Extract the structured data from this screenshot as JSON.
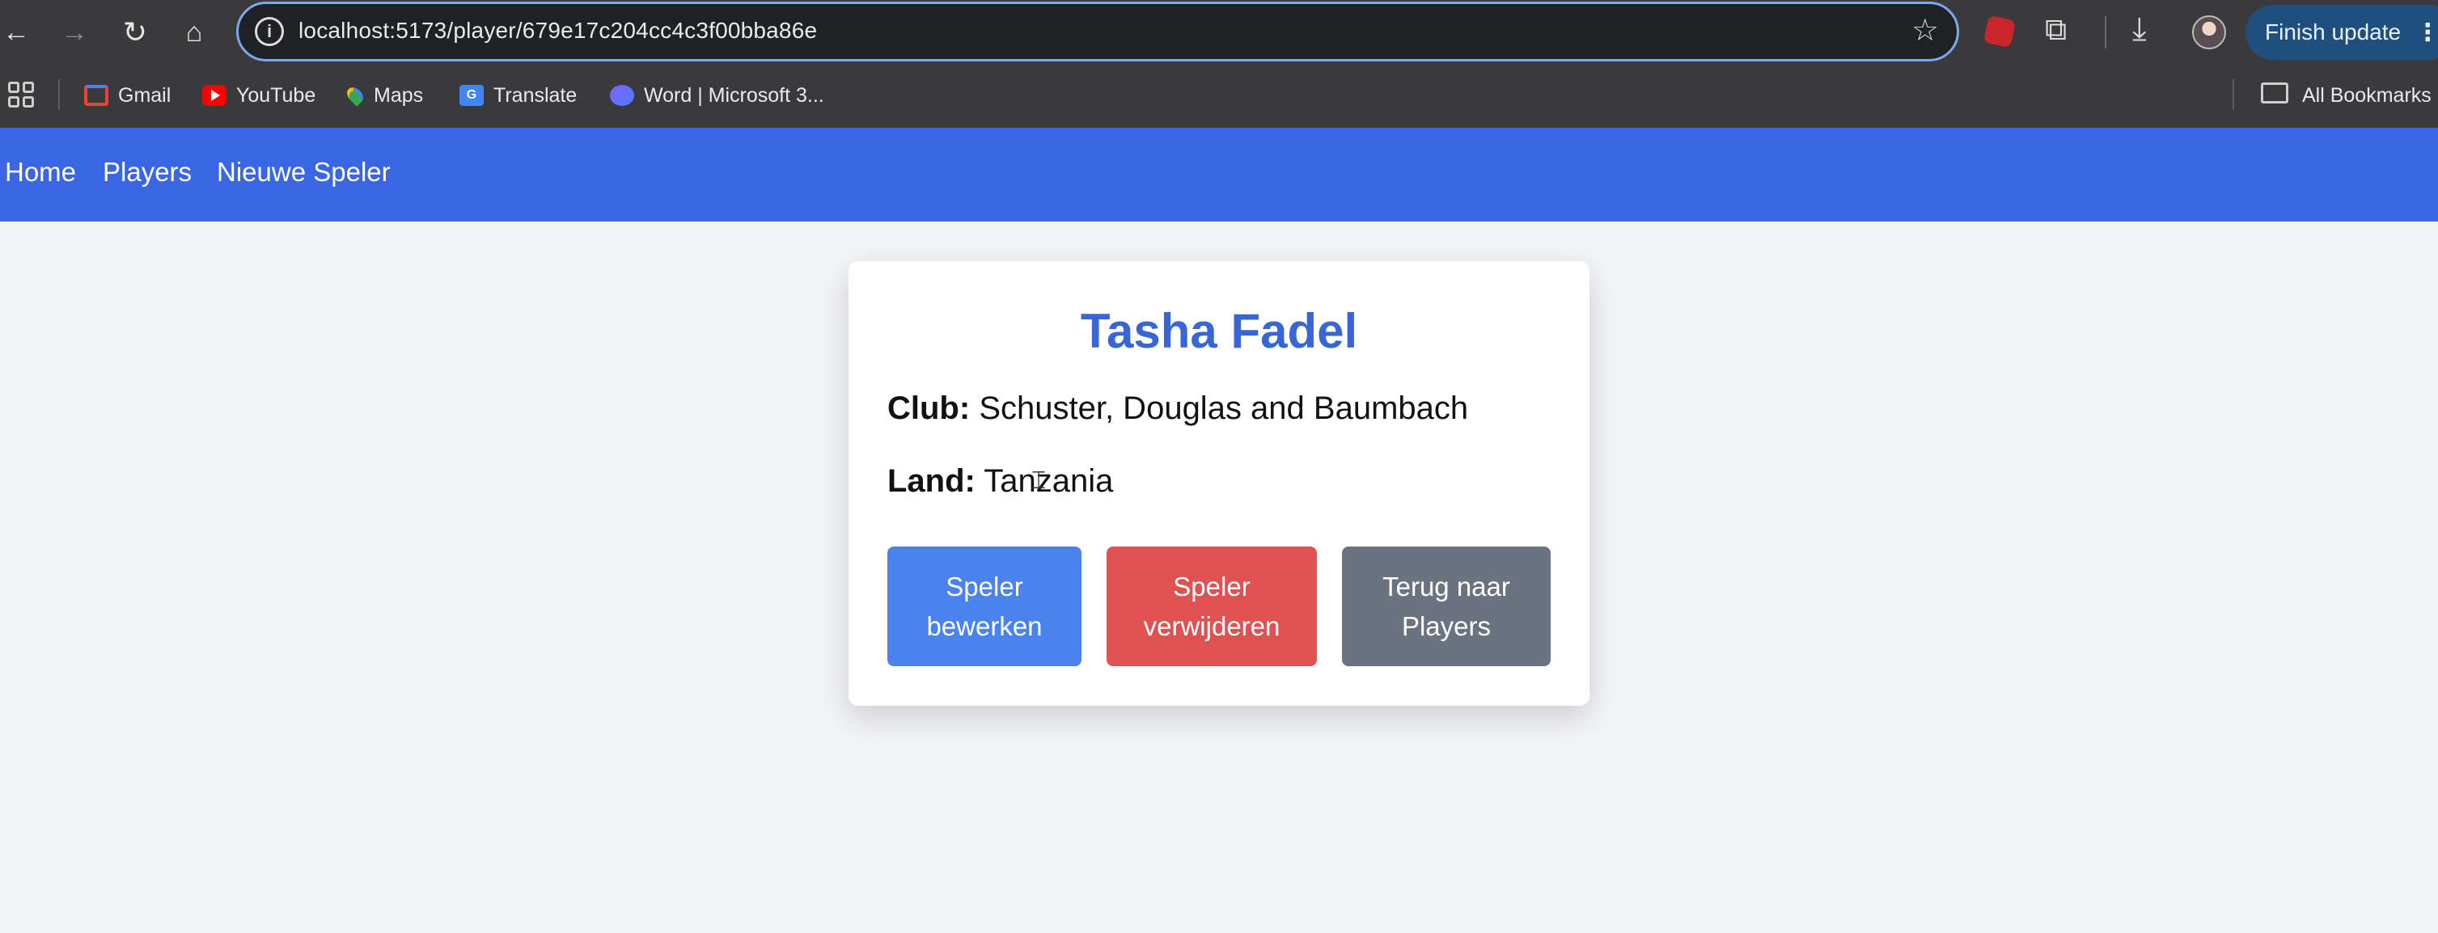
{
  "browser": {
    "url": "localhost:5173/player/679e17c204cc4c3f00bba86e",
    "finish_update": "Finish update",
    "bookmarks": [
      {
        "label": "Gmail",
        "icon": "gmail-icon"
      },
      {
        "label": "YouTube",
        "icon": "youtube-icon"
      },
      {
        "label": "Maps",
        "icon": "maps-icon"
      },
      {
        "label": "Translate",
        "icon": "translate-icon"
      },
      {
        "label": "Word | Microsoft 3...",
        "icon": "word-icon"
      }
    ],
    "all_bookmarks": "All Bookmarks"
  },
  "nav": {
    "home": "Home",
    "players": "Players",
    "new_player": "Nieuwe Speler"
  },
  "player": {
    "name": "Tasha Fadel",
    "club_label": "Club:",
    "club_value": "Schuster, Douglas and Baumbach",
    "land_label": "Land:",
    "land_value": "Tanzania"
  },
  "actions": {
    "edit": "Speler bewerken",
    "delete": "Speler verwijderen",
    "back": "Terug naar Players"
  },
  "colors": {
    "nav_bar": "#3966e2",
    "title": "#3966d6",
    "edit_button": "#4a82ee",
    "delete_button": "#e05252",
    "back_button": "#6b7280"
  }
}
